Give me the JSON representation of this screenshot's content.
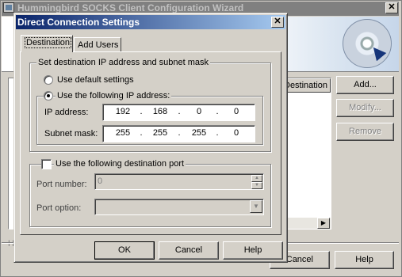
{
  "wizard": {
    "title": "Hummingbird SOCKS Client Configuration Wizard",
    "close_glyph": "✕",
    "list_column": "Destination Port",
    "buttons": {
      "add": "Add...",
      "modify": "Modify...",
      "remove": "Remove",
      "cancel": "Cancel",
      "help": "Help"
    },
    "stray_label": "H",
    "scroll_right": "▶"
  },
  "dialog": {
    "title": "Direct Connection Settings",
    "close_glyph": "✕",
    "tabs": [
      {
        "label": "Destination"
      },
      {
        "label": "Add Users"
      }
    ],
    "group_dest": {
      "label": "Set destination IP address and subnet mask",
      "radio_default": "Use default settings",
      "radio_following": "Use the following IP address:",
      "ip_label": "IP address:",
      "ip": [
        "192",
        "168",
        "0",
        "0"
      ],
      "mask_label": "Subnet mask:",
      "mask": [
        "255",
        "255",
        "255",
        "0"
      ],
      "dot": "."
    },
    "group_port": {
      "checkbox_label": "Use the following destination port",
      "port_label": "Port number:",
      "port_value": "0",
      "option_label": "Port option:",
      "option_value": ""
    },
    "buttons": {
      "ok": "OK",
      "cancel": "Cancel",
      "help": "Help"
    }
  }
}
